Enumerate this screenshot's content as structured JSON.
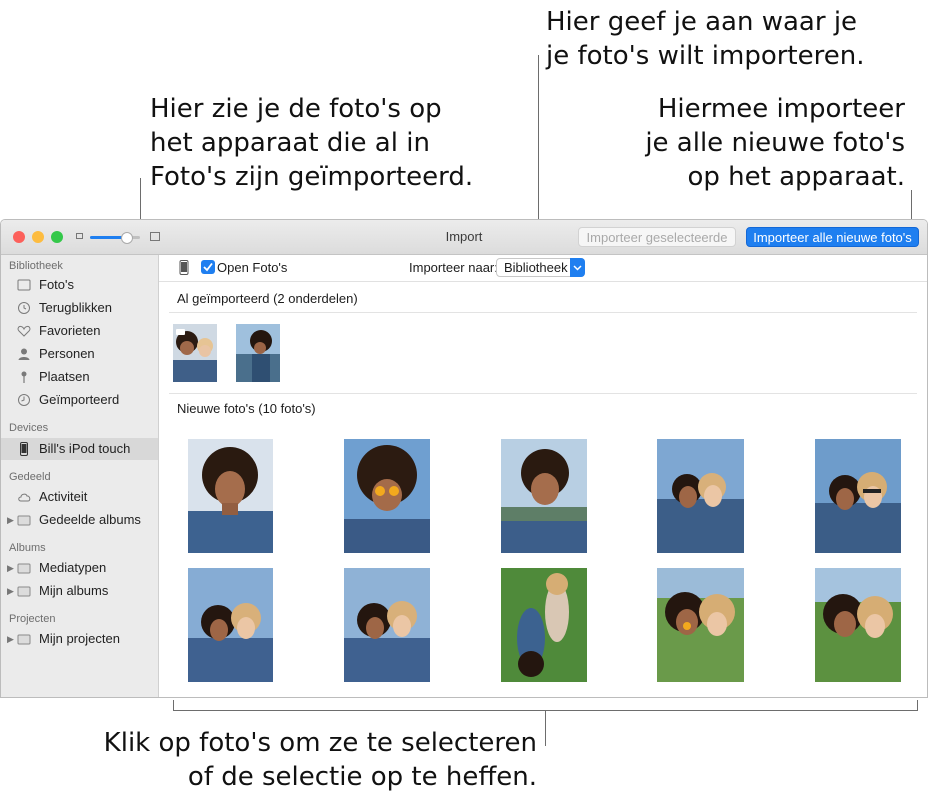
{
  "callouts": {
    "top_left": [
      "Hier zie je de foto's op",
      "het apparaat die al in",
      "Foto's zijn geïmporteerd."
    ],
    "top_center": [
      "Hier geef je aan waar je",
      "je foto's wilt importeren."
    ],
    "top_right": [
      "Hiermee importeer",
      "je alle nieuwe foto's",
      "op het apparaat."
    ],
    "bottom": [
      "Klik op foto's om ze te selecteren",
      "of de selectie op te heffen."
    ]
  },
  "window": {
    "title": "Import",
    "import_selected_label": "Importeer geselecteerde",
    "import_all_label": "Importeer alle nieuwe foto's"
  },
  "sidebar": {
    "sections": [
      {
        "title": "Bibliotheek",
        "items": [
          {
            "label": "Foto's",
            "icon": "photos-icon"
          },
          {
            "label": "Terugblikken",
            "icon": "memories-icon"
          },
          {
            "label": "Favorieten",
            "icon": "heart-icon"
          },
          {
            "label": "Personen",
            "icon": "person-icon"
          },
          {
            "label": "Plaatsen",
            "icon": "pin-icon"
          },
          {
            "label": "Geïmporteerd",
            "icon": "clock-icon"
          }
        ]
      },
      {
        "title": "Devices",
        "items": [
          {
            "label": "Bill's iPod touch",
            "icon": "ipod-icon",
            "selected": true
          }
        ]
      },
      {
        "title": "Gedeeld",
        "items": [
          {
            "label": "Activiteit",
            "icon": "cloud-icon"
          },
          {
            "label": "Gedeelde albums",
            "icon": "folder-icon",
            "disclosure": true
          }
        ]
      },
      {
        "title": "Albums",
        "items": [
          {
            "label": "Mediatypen",
            "icon": "folder-icon",
            "disclosure": true
          },
          {
            "label": "Mijn albums",
            "icon": "folder-icon",
            "disclosure": true
          }
        ]
      },
      {
        "title": "Projecten",
        "items": [
          {
            "label": "Mijn projecten",
            "icon": "folder-icon",
            "disclosure": true
          }
        ]
      }
    ]
  },
  "toolbar": {
    "open_photos_label": "Open Foto's",
    "open_photos_checked": true,
    "import_to_label": "Importeer naar:",
    "import_to_value": "Bibliotheek"
  },
  "sections": {
    "imported_title": "Al geïmporteerd (2 onderdelen)",
    "new_title": "Nieuwe foto's (10 foto's)"
  },
  "colors": {
    "accent": "#1f7ff0",
    "sidebar_bg": "#ebebeb",
    "selected_row": "#d8d8d8",
    "close": "#fc605b",
    "minimize": "#fdbc40",
    "zoom": "#34c84a"
  }
}
